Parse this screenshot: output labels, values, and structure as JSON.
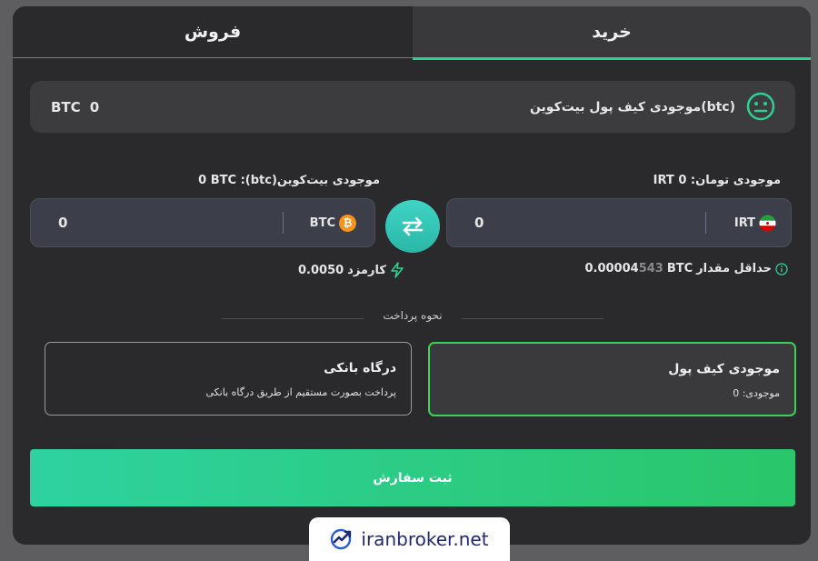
{
  "tabs": {
    "buy": "خرید",
    "sell": "فروش"
  },
  "wallet_bar": {
    "label": "موجودی کیف پول بیت‌کوین(btc)",
    "amount": "0",
    "currency": "BTC"
  },
  "toman_balance": {
    "label": "موجودی تومان:",
    "value": "0",
    "currency": "IRT"
  },
  "btc_balance": {
    "label": "موجودی بیت‌کوین(btc):",
    "value": "0",
    "currency": "BTC"
  },
  "irt_input": {
    "value": "0",
    "currency": "IRT"
  },
  "btc_input": {
    "value": "0",
    "currency": "BTC"
  },
  "min_amount": {
    "label": "حداقل مقدار",
    "currency": "BTC",
    "value_main": "0.00004",
    "value_dim": "543"
  },
  "fee": {
    "label": "کارمزد",
    "value": "0.0050"
  },
  "payment": {
    "section_label": "نحوه پرداخت",
    "wallet": {
      "title": "موجودی کیف پول",
      "desc": "موجودی: 0"
    },
    "bank": {
      "title": "درگاه بانکی",
      "desc": "پرداخت بصورت مستقیم از طریق درگاه بانکی"
    }
  },
  "submit_label": "ثبت سفارش",
  "watermark": "iranbroker.net",
  "colors": {
    "accent": "#2ecf92",
    "selected_border": "#3fcf5a",
    "panel": "#2a2a2c"
  }
}
